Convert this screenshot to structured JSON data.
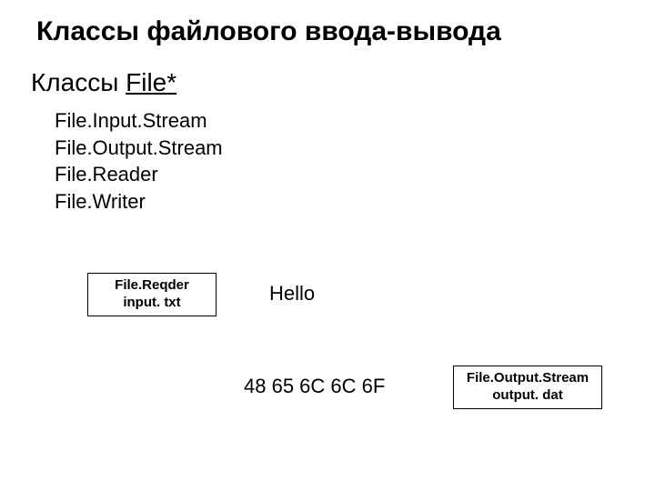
{
  "title": "Классы файлового ввода-вывода",
  "subtitle_plain": "Классы ",
  "subtitle_underlined": "File*",
  "classes": {
    "item1": "File.Input.Stream",
    "item2": "File.Output.Stream",
    "item3": "File.Reader",
    "item4": "File.Writer"
  },
  "box_left": {
    "line1": "File.Reqder",
    "line2": "input. txt"
  },
  "hello_text": "Hello",
  "hex_text": "48 65 6C 6C 6F",
  "box_right": {
    "line1": "File.Output.Stream",
    "line2": "output. dat"
  }
}
